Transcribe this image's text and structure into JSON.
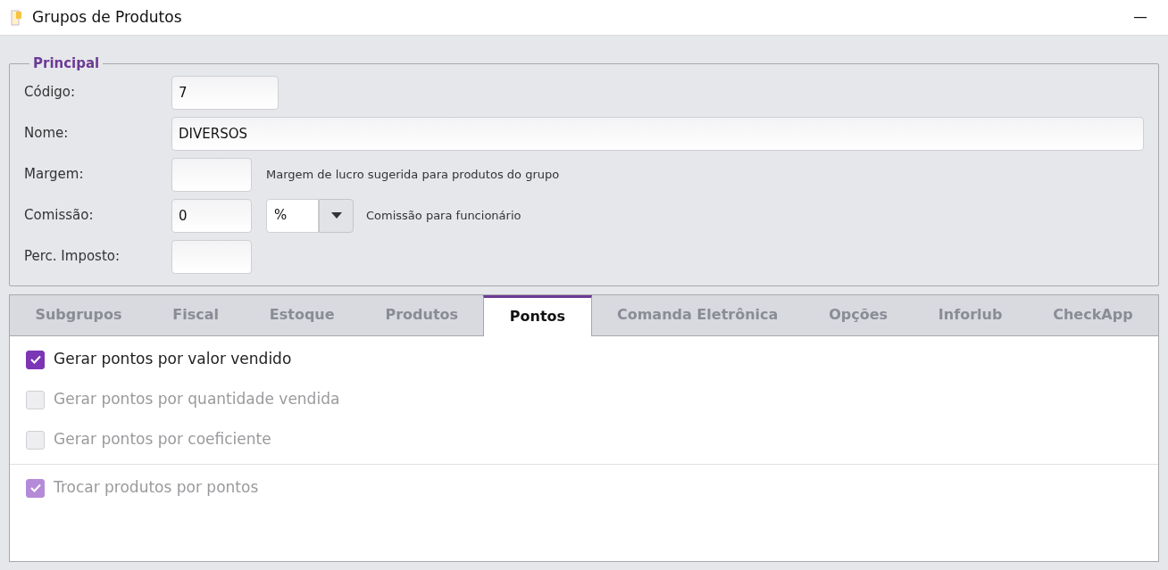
{
  "window": {
    "title": "Grupos de Produtos"
  },
  "principal": {
    "legend": "Principal",
    "rows": [
      {
        "label": "Código:",
        "kind": "medium",
        "value": "7"
      },
      {
        "label": "Nome:",
        "kind": "wide",
        "value": "DIVERSOS"
      },
      {
        "label": "Margem:",
        "kind": "short",
        "value": "",
        "hint": "Margem de lucro sugerida para produtos do grupo"
      },
      {
        "label": "Comissão:",
        "kind": "short",
        "value": "0",
        "select": "%",
        "hint": "Comissão para funcionário"
      },
      {
        "label": "Perc. Imposto:",
        "kind": "short",
        "value": ""
      }
    ]
  },
  "tabs": [
    {
      "label": "Subgrupos",
      "selected": false
    },
    {
      "label": "Fiscal",
      "selected": false
    },
    {
      "label": "Estoque",
      "selected": false
    },
    {
      "label": "Produtos",
      "selected": false
    },
    {
      "label": "Pontos",
      "selected": true
    },
    {
      "label": "Comanda Eletrônica",
      "selected": false
    },
    {
      "label": "Opções",
      "selected": false
    },
    {
      "label": "Inforlub",
      "selected": false
    },
    {
      "label": "CheckApp",
      "selected": false
    }
  ],
  "option_groups": [
    {
      "options": [
        {
          "label": "Gerar pontos por valor vendido",
          "checked": true,
          "disabled": false
        },
        {
          "label": "Gerar pontos por quantidade vendida",
          "checked": false,
          "disabled": true
        },
        {
          "label": "Gerar pontos por coeficiente",
          "checked": false,
          "disabled": true
        }
      ]
    },
    {
      "options": [
        {
          "label": "Trocar produtos por pontos",
          "checked": true,
          "disabled": true
        }
      ]
    }
  ]
}
